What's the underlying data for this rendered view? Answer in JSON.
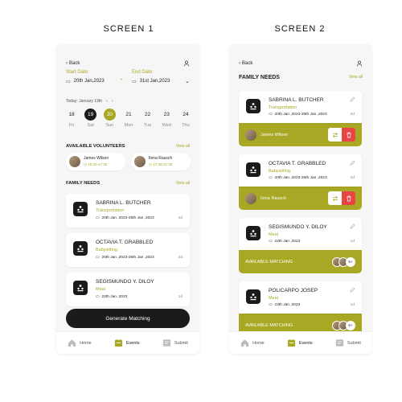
{
  "screen1": {
    "title": "SCREEN 1",
    "back": "Back",
    "start_label": "Start Date:",
    "start_value": "20th Jan,2023",
    "end_label": "End Date:",
    "end_value": "31st Jan,2023",
    "today": "Today: January 19th",
    "days": [
      {
        "num": "18",
        "lbl": "Fri"
      },
      {
        "num": "19",
        "lbl": "Sat"
      },
      {
        "num": "20",
        "lbl": "Sun"
      },
      {
        "num": "21",
        "lbl": "Mon"
      },
      {
        "num": "22",
        "lbl": "Tue"
      },
      {
        "num": "23",
        "lbl": "Wed"
      },
      {
        "num": "24",
        "lbl": "Thu"
      }
    ],
    "volunteers_title": "AVAILABLE VOLUNTEERS",
    "view_all": "View all",
    "volunteers": [
      {
        "name": "James Wilson",
        "time": "15:30-17:30"
      },
      {
        "name": "Ilona Rausch",
        "time": "17:30-21:00"
      }
    ],
    "needs_title": "FAMILY NEEDS",
    "needs": [
      {
        "name": "SABRINA L. BUTCHER",
        "type": "Transportation",
        "dates": "20th Jan ,2023-25th Jan ,2023",
        "dur": "4d"
      },
      {
        "name": "OCTAVIA T. GRABBLED",
        "type": "Babysitting",
        "dates": "20th Jan ,2023-25th Jan ,2023",
        "dur": "4d"
      },
      {
        "name": "SEGISMUNDO Y. DILOY",
        "type": "Meal",
        "dates": "22th Jan ,2023",
        "dur": "1d"
      }
    ],
    "generate": "Generate Matching"
  },
  "screen2": {
    "title": "SCREEN 2",
    "back": "Back",
    "needs_title": "FAMILY NEEDS",
    "view_all": "View all",
    "cards": [
      {
        "name": "SABRINA L. BUTCHER",
        "type": "Transportation",
        "dates": "20th Jan ,2023-25th Jan ,2023",
        "dur": "4d",
        "assigned": "James Wilson"
      },
      {
        "name": "OCTAVIA T. GRABBLED",
        "type": "Babysitting",
        "dates": "20th Jan ,2023-25th Jan ,2023",
        "dur": "4d",
        "assigned": "Ilona Rausch"
      },
      {
        "name": "SEGISMUNDO Y. DILOY",
        "type": "Meal",
        "dates": "22th Jan ,2023",
        "dur": "1d",
        "matching": "AVAILABLE MATCHING",
        "more": "5+"
      },
      {
        "name": "POLICARPO JOSEP",
        "type": "Meal",
        "dates": "23th Jan ,2023",
        "dur": "1d",
        "matching": "AVAILABLE MATCHING",
        "more": "5+"
      }
    ]
  },
  "nav": {
    "home": "Home",
    "events": "Events",
    "submit": "Submit"
  },
  "colors": {
    "accent": "#a8a824",
    "dark": "#1b1b1b",
    "danger": "#e84545"
  }
}
